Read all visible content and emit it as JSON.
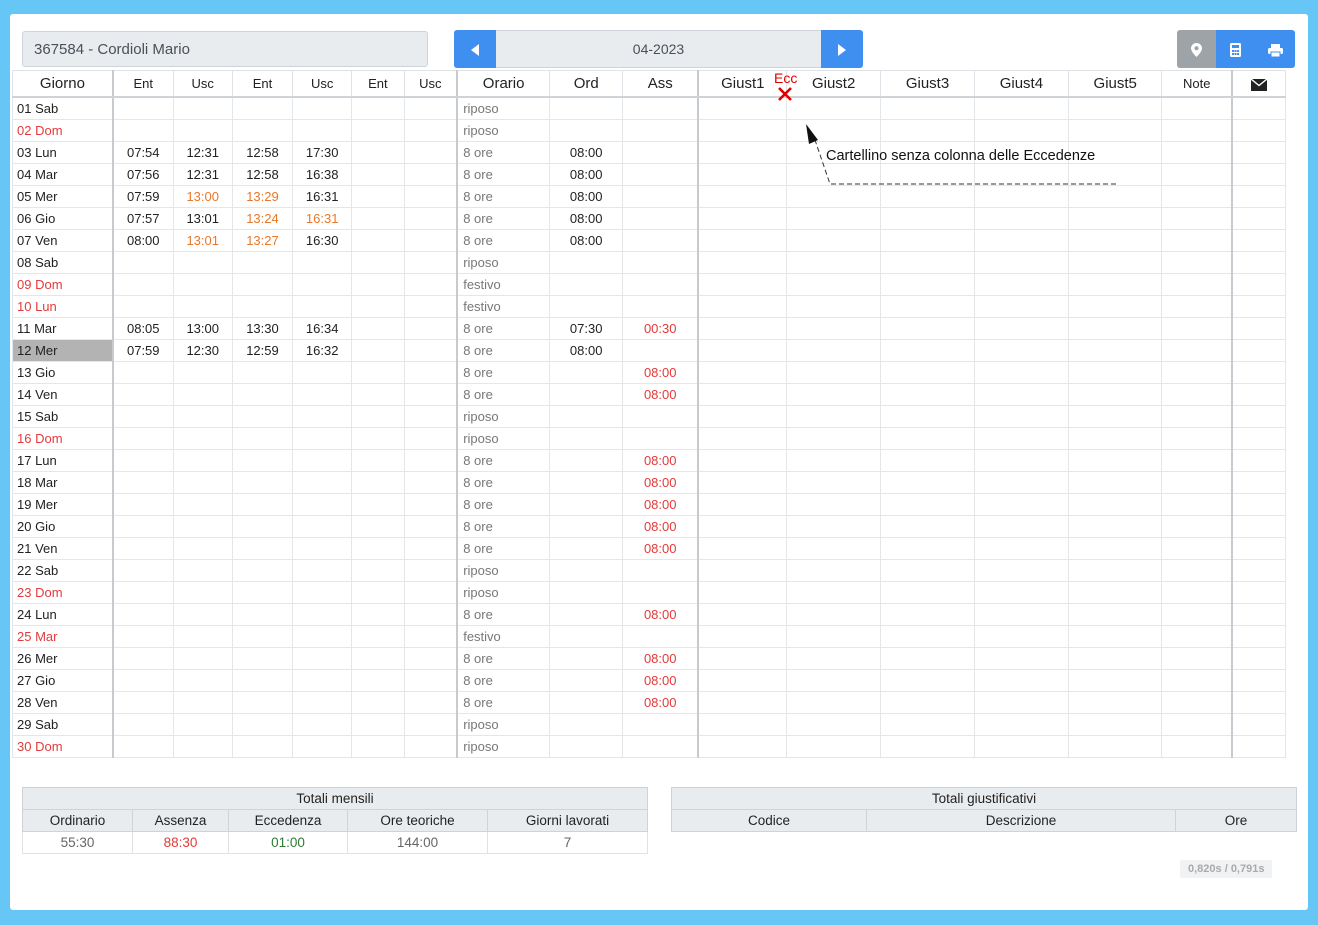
{
  "employee": {
    "label": "367584 - Cordioli Mario"
  },
  "month_nav": {
    "prev_icon": "caret-left-icon",
    "value": "04-2023",
    "next_icon": "caret-right-icon"
  },
  "tools": {
    "map_icon": "map-marker-icon",
    "calc_icon": "calculator-icon",
    "print_icon": "printer-icon"
  },
  "columns": [
    "Giorno",
    "Ent",
    "Usc",
    "Ent",
    "Usc",
    "Ent",
    "Usc",
    "Orario",
    "Ord",
    "Ass",
    "Giust1",
    "Giust2",
    "Giust3",
    "Giust4",
    "Giust5",
    "Note",
    "✉"
  ],
  "rows": [
    {
      "day": "01 Sab",
      "red": false,
      "times": [
        "",
        "",
        "",
        "",
        "",
        ""
      ],
      "orange": [],
      "orario": "riposo",
      "ord": "",
      "ass": ""
    },
    {
      "day": "02 Dom",
      "red": true,
      "times": [
        "",
        "",
        "",
        "",
        "",
        ""
      ],
      "orange": [],
      "orario": "riposo",
      "ord": "",
      "ass": ""
    },
    {
      "day": "03 Lun",
      "red": false,
      "times": [
        "07:54",
        "12:31",
        "12:58",
        "17:30",
        "",
        ""
      ],
      "orange": [],
      "orario": "8 ore",
      "ord": "08:00",
      "ass": ""
    },
    {
      "day": "04 Mar",
      "red": false,
      "times": [
        "07:56",
        "12:31",
        "12:58",
        "16:38",
        "",
        ""
      ],
      "orange": [],
      "orario": "8 ore",
      "ord": "08:00",
      "ass": ""
    },
    {
      "day": "05 Mer",
      "red": false,
      "times": [
        "07:59",
        "13:00",
        "13:29",
        "16:31",
        "",
        ""
      ],
      "orange": [
        1,
        2
      ],
      "orario": "8 ore",
      "ord": "08:00",
      "ass": ""
    },
    {
      "day": "06 Gio",
      "red": false,
      "times": [
        "07:57",
        "13:01",
        "13:24",
        "16:31",
        "",
        ""
      ],
      "orange": [
        2,
        3
      ],
      "orario": "8 ore",
      "ord": "08:00",
      "ass": ""
    },
    {
      "day": "07 Ven",
      "red": false,
      "times": [
        "08:00",
        "13:01",
        "13:27",
        "16:30",
        "",
        ""
      ],
      "orange": [
        1,
        2
      ],
      "orario": "8 ore",
      "ord": "08:00",
      "ass": ""
    },
    {
      "day": "08 Sab",
      "red": false,
      "times": [
        "",
        "",
        "",
        "",
        "",
        ""
      ],
      "orange": [],
      "orario": "riposo",
      "ord": "",
      "ass": ""
    },
    {
      "day": "09 Dom",
      "red": true,
      "times": [
        "",
        "",
        "",
        "",
        "",
        ""
      ],
      "orange": [],
      "orario": "festivo",
      "ord": "",
      "ass": ""
    },
    {
      "day": "10 Lun",
      "red": true,
      "times": [
        "",
        "",
        "",
        "",
        "",
        ""
      ],
      "orange": [],
      "orario": "festivo",
      "ord": "",
      "ass": ""
    },
    {
      "day": "11 Mar",
      "red": false,
      "times": [
        "08:05",
        "13:00",
        "13:30",
        "16:34",
        "",
        ""
      ],
      "orange": [],
      "orario": "8 ore",
      "ord": "07:30",
      "ass": "00:30"
    },
    {
      "day": "12 Mer",
      "red": false,
      "selected": true,
      "times": [
        "07:59",
        "12:30",
        "12:59",
        "16:32",
        "",
        ""
      ],
      "orange": [],
      "orario": "8 ore",
      "ord": "08:00",
      "ass": ""
    },
    {
      "day": "13 Gio",
      "red": false,
      "times": [
        "",
        "",
        "",
        "",
        "",
        ""
      ],
      "orange": [],
      "orario": "8 ore",
      "ord": "",
      "ass": "08:00"
    },
    {
      "day": "14 Ven",
      "red": false,
      "times": [
        "",
        "",
        "",
        "",
        "",
        ""
      ],
      "orange": [],
      "orario": "8 ore",
      "ord": "",
      "ass": "08:00"
    },
    {
      "day": "15 Sab",
      "red": false,
      "times": [
        "",
        "",
        "",
        "",
        "",
        ""
      ],
      "orange": [],
      "orario": "riposo",
      "ord": "",
      "ass": ""
    },
    {
      "day": "16 Dom",
      "red": true,
      "times": [
        "",
        "",
        "",
        "",
        "",
        ""
      ],
      "orange": [],
      "orario": "riposo",
      "ord": "",
      "ass": ""
    },
    {
      "day": "17 Lun",
      "red": false,
      "times": [
        "",
        "",
        "",
        "",
        "",
        ""
      ],
      "orange": [],
      "orario": "8 ore",
      "ord": "",
      "ass": "08:00"
    },
    {
      "day": "18 Mar",
      "red": false,
      "times": [
        "",
        "",
        "",
        "",
        "",
        ""
      ],
      "orange": [],
      "orario": "8 ore",
      "ord": "",
      "ass": "08:00"
    },
    {
      "day": "19 Mer",
      "red": false,
      "times": [
        "",
        "",
        "",
        "",
        "",
        ""
      ],
      "orange": [],
      "orario": "8 ore",
      "ord": "",
      "ass": "08:00"
    },
    {
      "day": "20 Gio",
      "red": false,
      "times": [
        "",
        "",
        "",
        "",
        "",
        ""
      ],
      "orange": [],
      "orario": "8 ore",
      "ord": "",
      "ass": "08:00"
    },
    {
      "day": "21 Ven",
      "red": false,
      "times": [
        "",
        "",
        "",
        "",
        "",
        ""
      ],
      "orange": [],
      "orario": "8 ore",
      "ord": "",
      "ass": "08:00"
    },
    {
      "day": "22 Sab",
      "red": false,
      "times": [
        "",
        "",
        "",
        "",
        "",
        ""
      ],
      "orange": [],
      "orario": "riposo",
      "ord": "",
      "ass": ""
    },
    {
      "day": "23 Dom",
      "red": true,
      "times": [
        "",
        "",
        "",
        "",
        "",
        ""
      ],
      "orange": [],
      "orario": "riposo",
      "ord": "",
      "ass": ""
    },
    {
      "day": "24 Lun",
      "red": false,
      "times": [
        "",
        "",
        "",
        "",
        "",
        ""
      ],
      "orange": [],
      "orario": "8 ore",
      "ord": "",
      "ass": "08:00"
    },
    {
      "day": "25 Mar",
      "red": true,
      "times": [
        "",
        "",
        "",
        "",
        "",
        ""
      ],
      "orange": [],
      "orario": "festivo",
      "ord": "",
      "ass": ""
    },
    {
      "day": "26 Mer",
      "red": false,
      "times": [
        "",
        "",
        "",
        "",
        "",
        ""
      ],
      "orange": [],
      "orario": "8 ore",
      "ord": "",
      "ass": "08:00"
    },
    {
      "day": "27 Gio",
      "red": false,
      "times": [
        "",
        "",
        "",
        "",
        "",
        ""
      ],
      "orange": [],
      "orario": "8 ore",
      "ord": "",
      "ass": "08:00"
    },
    {
      "day": "28 Ven",
      "red": false,
      "times": [
        "",
        "",
        "",
        "",
        "",
        ""
      ],
      "orange": [],
      "orario": "8 ore",
      "ord": "",
      "ass": "08:00"
    },
    {
      "day": "29 Sab",
      "red": false,
      "times": [
        "",
        "",
        "",
        "",
        "",
        ""
      ],
      "orange": [],
      "orario": "riposo",
      "ord": "",
      "ass": ""
    },
    {
      "day": "30 Dom",
      "red": true,
      "times": [
        "",
        "",
        "",
        "",
        "",
        ""
      ],
      "orange": [],
      "orario": "riposo",
      "ord": "",
      "ass": ""
    }
  ],
  "annotation": {
    "ecc_label": "Ecc",
    "cross_icon": "red-cross-icon",
    "text": "Cartellino senza colonna delle Eccedenze"
  },
  "totali_mensili": {
    "title": "Totali mensili",
    "headers": [
      "Ordinario",
      "Assenza",
      "Eccedenza",
      "Ore teoriche",
      "Giorni lavorati"
    ],
    "values": [
      "55:30",
      "88:30",
      "01:00",
      "144:00",
      "7"
    ],
    "colors": [
      "#666666",
      "#e23b3b",
      "#2e7d32",
      "#666666",
      "#666666"
    ]
  },
  "totali_giustificativi": {
    "title": "Totali giustificativi",
    "headers": [
      "Codice",
      "Descrizione",
      "Ore"
    ]
  },
  "timing": "0,820s / 0,791s",
  "colors": {
    "accent": "#3f8ff0",
    "background": "#66c7f7",
    "weekend_red": "#e23b3b",
    "late_orange": "#e8782a"
  }
}
